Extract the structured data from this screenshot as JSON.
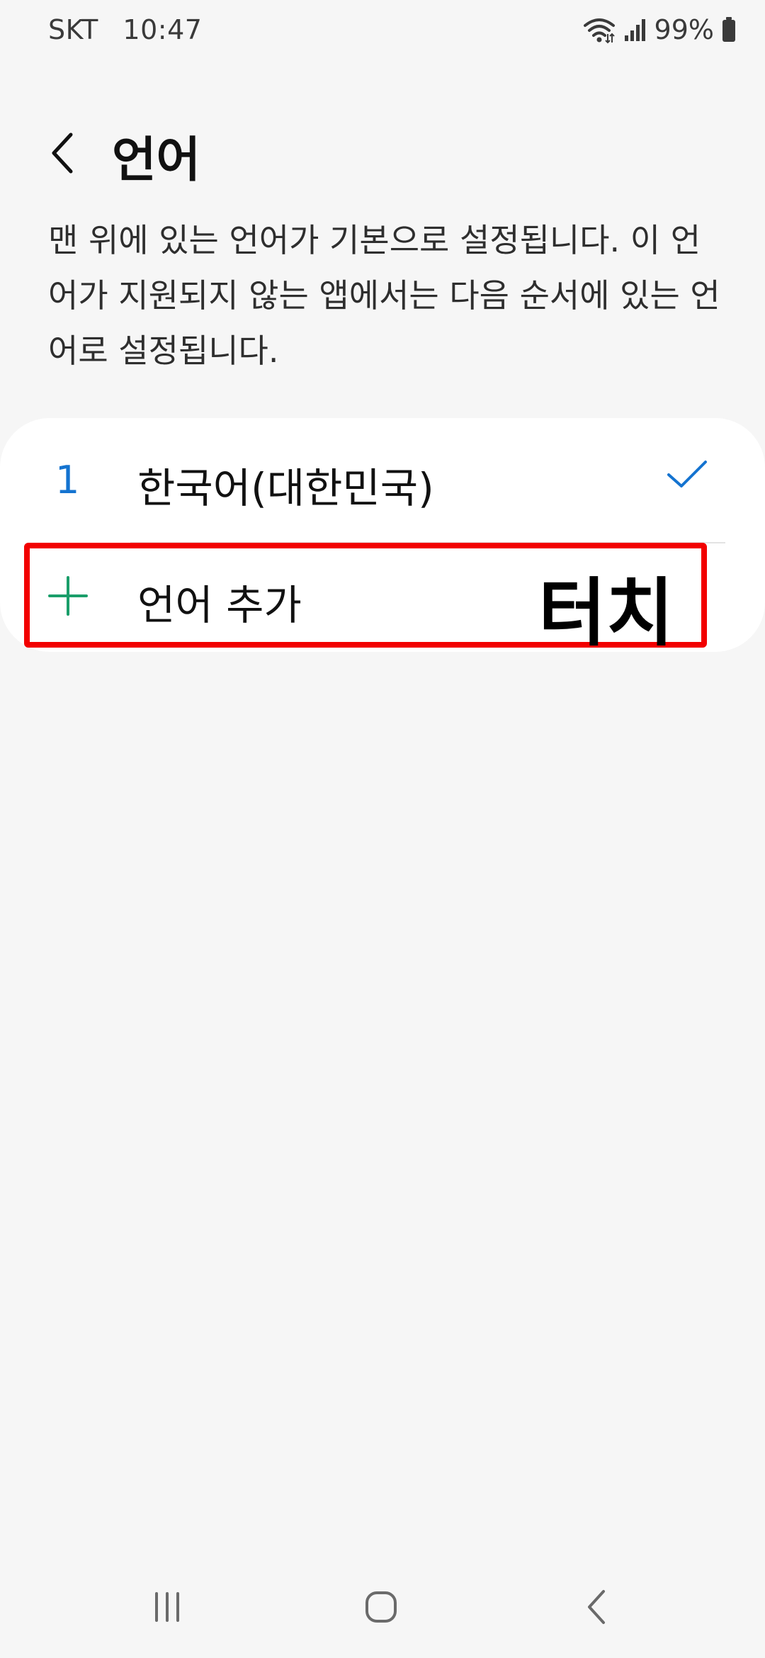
{
  "status_bar": {
    "carrier": "SKT",
    "time": "10:47",
    "battery": "99%",
    "icons": [
      "wifi-icon",
      "signal-icon",
      "battery-icon"
    ]
  },
  "header": {
    "back_icon": "back-arrow-icon",
    "title": "언어"
  },
  "description": {
    "text": "맨 위에 있는 언어가 기본으로 설정됩니다. 이 언어가 지원되지 않는 앱에서는 다음 순서에 있는 언어로 설정됩니다."
  },
  "languages": [
    {
      "number": "1",
      "name": "한국어(대한민국)",
      "selected": true,
      "icon": "checkmark-icon"
    }
  ],
  "add_language": {
    "icon": "plus-icon",
    "label": "언어 추가"
  },
  "annotation": {
    "text": "터치",
    "highlight_color": "#f20000"
  },
  "navigation": {
    "icons": [
      "recent-apps-icon",
      "home-icon",
      "back-icon"
    ]
  },
  "colors": {
    "background": "#f6f6f6",
    "card": "#ffffff",
    "accent_blue": "#1473d0",
    "plus_green": "#1a9e6a"
  }
}
